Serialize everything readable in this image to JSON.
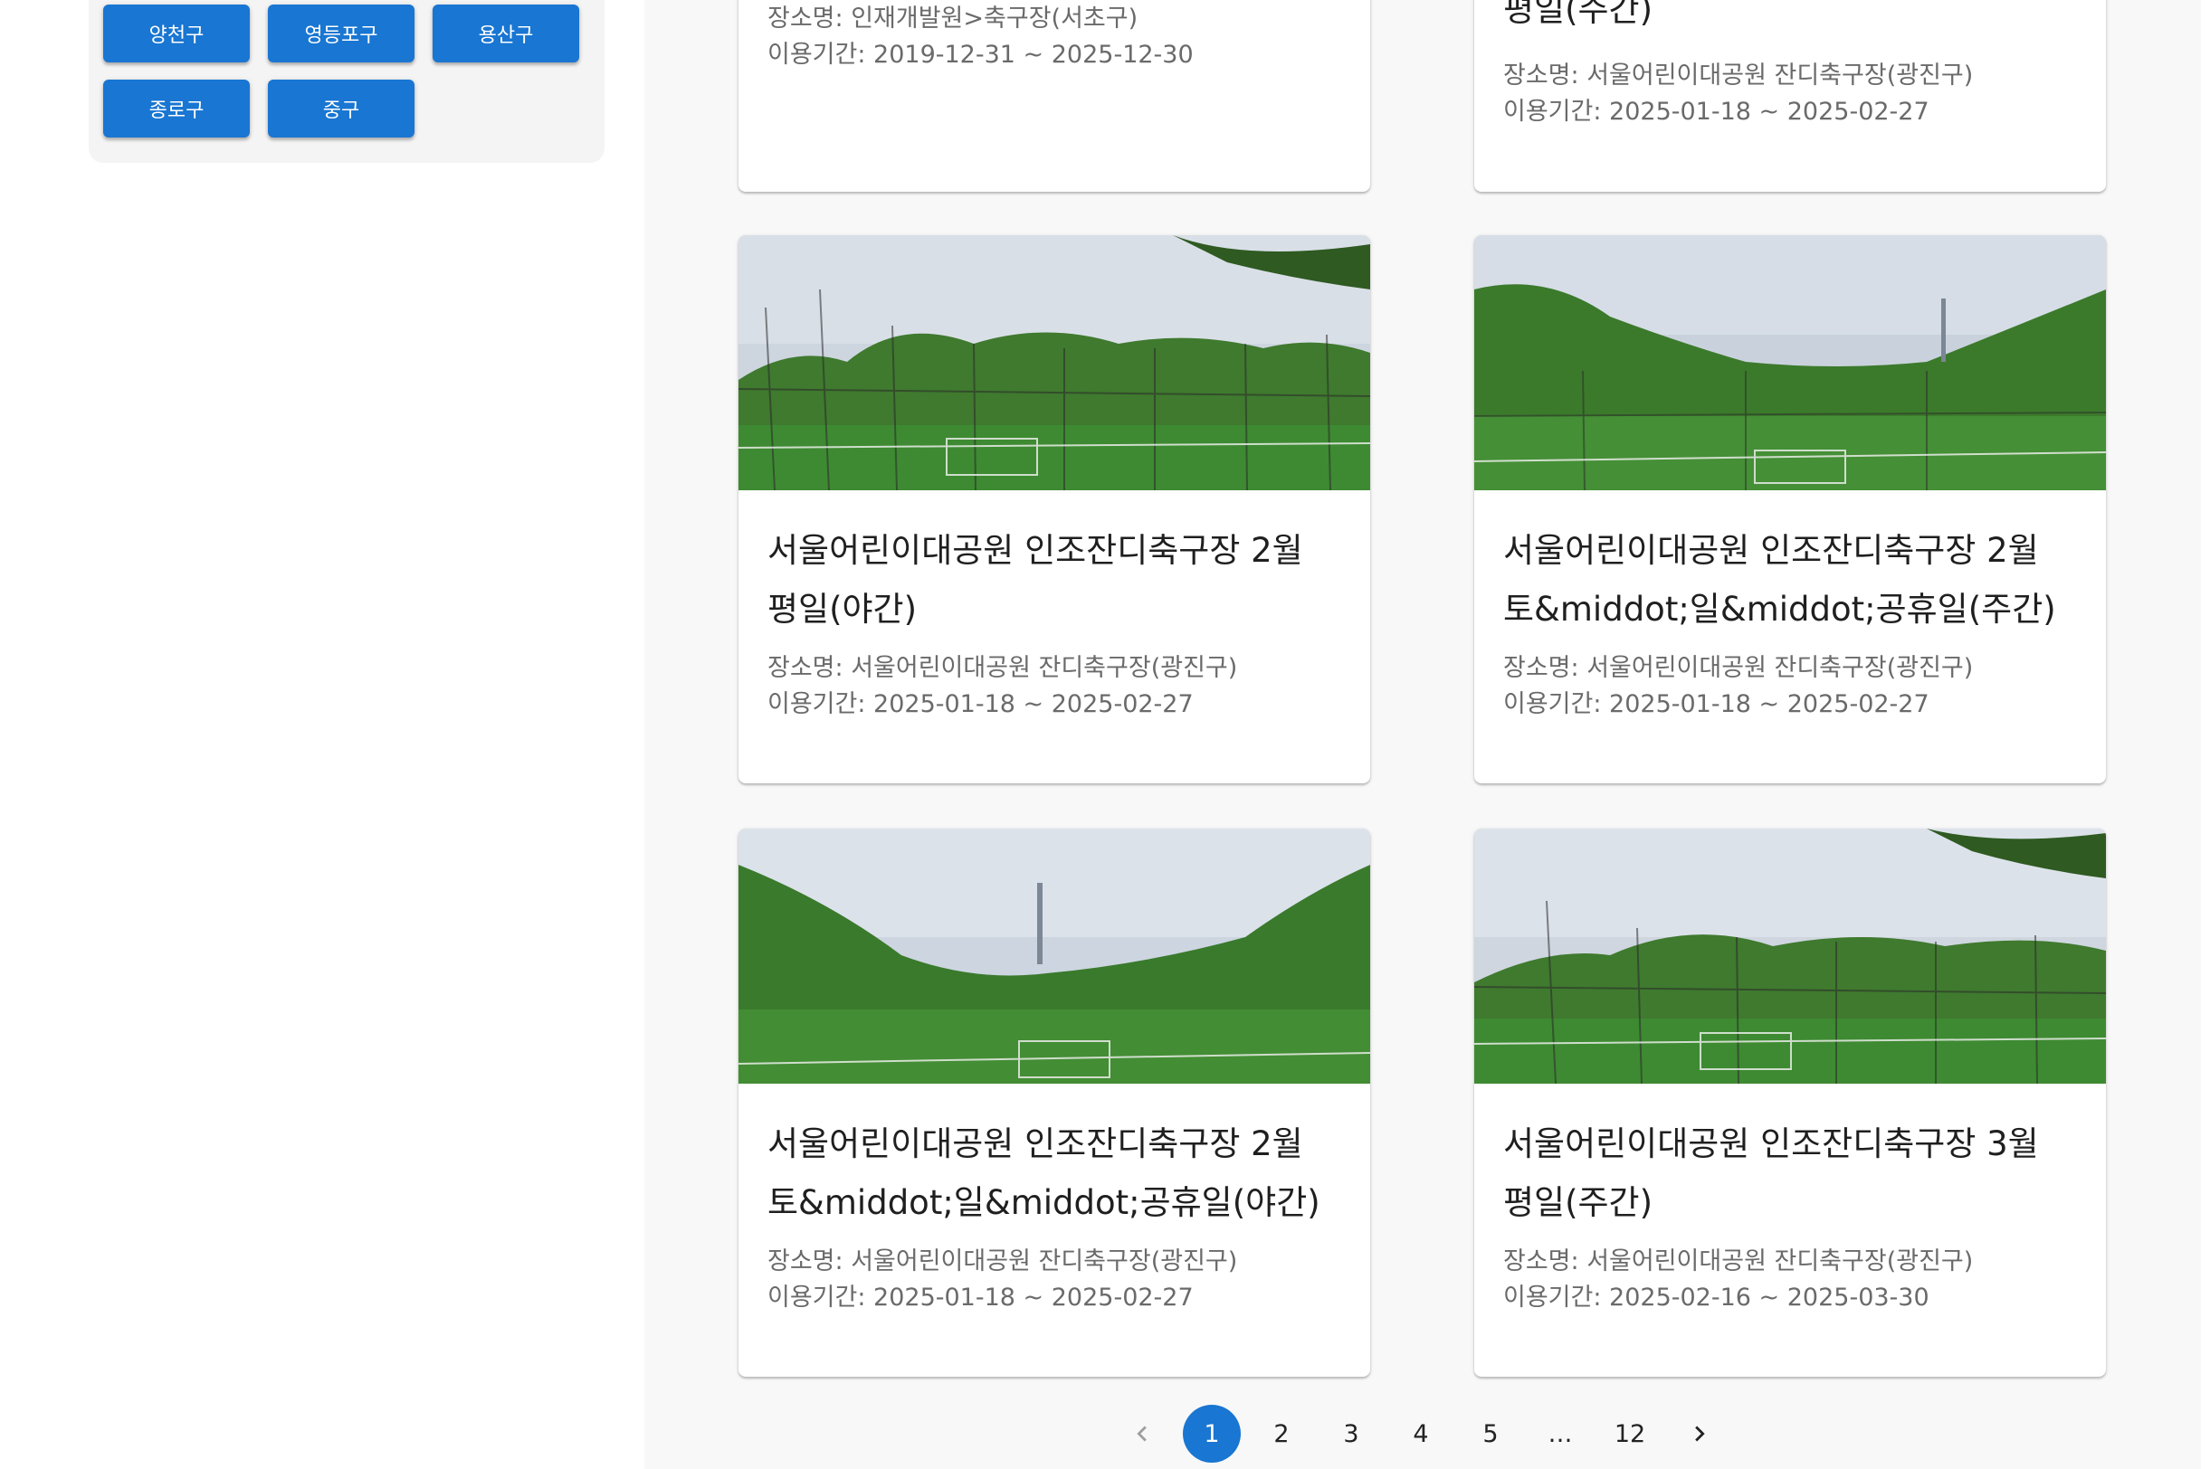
{
  "sidebar": {
    "districts": [
      "양천구",
      "영등포구",
      "용산구",
      "종로구",
      "중구"
    ]
  },
  "cards": [
    {
      "title_line1": "",
      "title_line2": "",
      "place": "장소명: 인재개발원>축구장(서초구)",
      "period": "이용기간: 2019-12-31 ~ 2025-12-30"
    },
    {
      "title_line1": "",
      "title_line2": "평일(주간)",
      "place": "장소명: 서울어린이대공원 잔디축구장(광진구)",
      "period": "이용기간: 2025-01-18 ~ 2025-02-27"
    },
    {
      "title_line1": "서울어린이대공원 인조잔디축구장 2월",
      "title_line2": "평일(야간)",
      "place": "장소명: 서울어린이대공원 잔디축구장(광진구)",
      "period": "이용기간: 2025-01-18 ~ 2025-02-27"
    },
    {
      "title_line1": "서울어린이대공원 인조잔디축구장 2월",
      "title_line2": "토&middot;일&middot;공휴일(주간)",
      "place": "장소명: 서울어린이대공원 잔디축구장(광진구)",
      "period": "이용기간: 2025-01-18 ~ 2025-02-27"
    },
    {
      "title_line1": "서울어린이대공원 인조잔디축구장 2월",
      "title_line2": "토&middot;일&middot;공휴일(야간)",
      "place": "장소명: 서울어린이대공원 잔디축구장(광진구)",
      "period": "이용기간: 2025-01-18 ~ 2025-02-27"
    },
    {
      "title_line1": "서울어린이대공원 인조잔디축구장 3월",
      "title_line2": "평일(주간)",
      "place": "장소명: 서울어린이대공원 잔디축구장(광진구)",
      "period": "이용기간: 2025-02-16 ~ 2025-03-30"
    }
  ],
  "pagination": {
    "pages": [
      "1",
      "2",
      "3",
      "4",
      "5",
      "…",
      "12"
    ],
    "current": "1"
  },
  "colors": {
    "primary": "#1976d2",
    "page_bg": "#f8f8f8",
    "panel_bg": "#f4f4f4",
    "text_meta": "#6a6a6a"
  },
  "icons": {
    "prev": "chevron-left-icon",
    "next": "chevron-right-icon"
  }
}
